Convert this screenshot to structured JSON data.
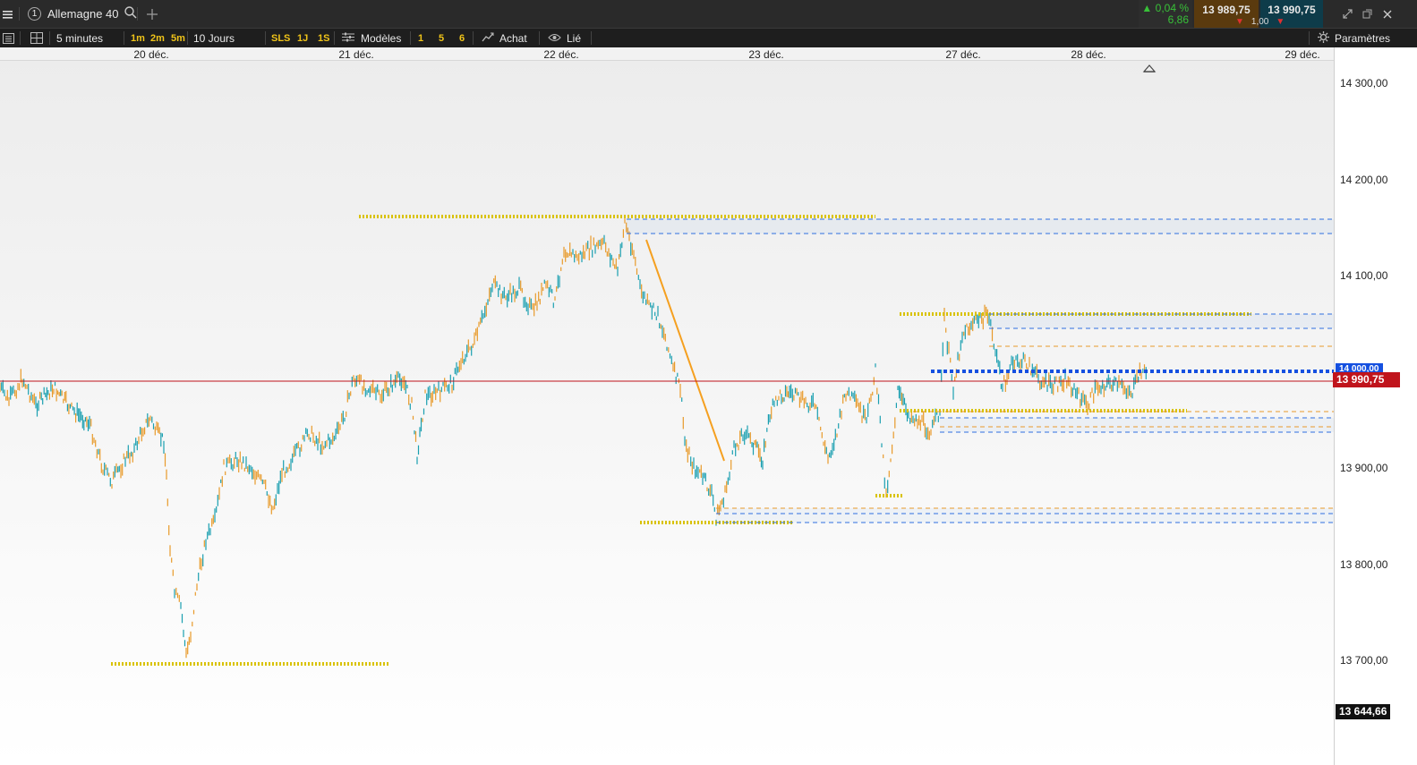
{
  "topbar": {
    "instrument_number": "1",
    "instrument": "Allemagne 40",
    "change_pct": "0,04 %",
    "change_abs": "6,86",
    "bid": "13 989,75",
    "ask": "13 990,75",
    "spread": "1,00"
  },
  "toolbar": {
    "interval": "5 minutes",
    "quick_1m": "1m",
    "quick_2m": "2m",
    "quick_5m": "5m",
    "range": "10 Jours",
    "sls": "SLS",
    "q1j": "1J",
    "q1s": "1S",
    "models": "Modèles",
    "n1": "1",
    "n5": "5",
    "n6": "6",
    "buy": "Achat",
    "linked": "Lié",
    "settings": "Paramètres"
  },
  "xaxis": {
    "labels": [
      "20 déc.",
      "21 déc.",
      "22 déc.",
      "23 déc.",
      "27 déc.",
      "28 déc.",
      "29 déc."
    ]
  },
  "yaxis": {
    "labels": [
      "14 300,00",
      "14 200,00",
      "14 100,00",
      "13 900,00",
      "13 800,00",
      "13 700,00"
    ],
    "current_price": "13 990,75",
    "hidden_price": "14 000,00",
    "bottom_price": "13 644,66"
  },
  "colors": {
    "up": "#1a9fb0",
    "down": "#e89a2a",
    "support": "#e2c400",
    "zone": "#2f6fe0",
    "current": "#c0141c"
  }
}
